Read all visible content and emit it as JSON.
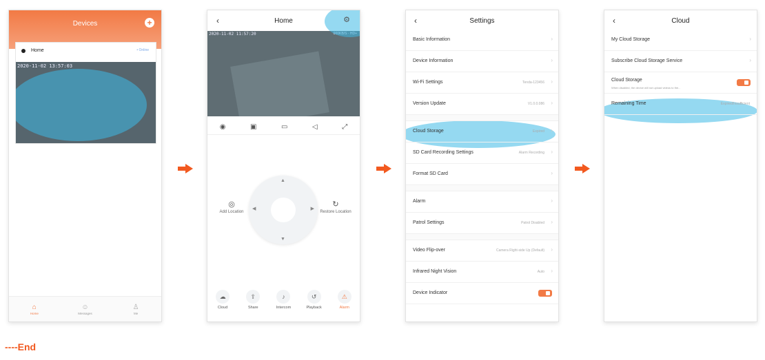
{
  "phone1": {
    "title": "Devices",
    "add_icon": "plus-icon",
    "device_name": "Home",
    "device_status": "• Online",
    "timestamp": "2020-11-02 13:57:03",
    "tabs": [
      {
        "label": "Home",
        "icon": "home-icon"
      },
      {
        "label": "Messages",
        "icon": "message-icon"
      },
      {
        "label": "Me",
        "icon": "user-icon"
      }
    ]
  },
  "phone2": {
    "title": "Home",
    "timestamp": "2020-11-02 11:57:20",
    "video_info": "000KB/S · HD+",
    "controls": [
      "eye-icon",
      "camera-icon",
      "record-icon",
      "speaker-icon",
      "fullscreen-icon"
    ],
    "add_location": "Add Location",
    "restore_location": "Restore Location",
    "bottom": [
      {
        "label": "Cloud",
        "icon": "cloud-icon"
      },
      {
        "label": "Share",
        "icon": "share-icon"
      },
      {
        "label": "Intercom",
        "icon": "mic-icon"
      },
      {
        "label": "Playback",
        "icon": "playback-icon"
      },
      {
        "label": "Alarm",
        "icon": "alarm-icon"
      }
    ]
  },
  "phone3": {
    "title": "Settings",
    "items": [
      {
        "label": "Basic Information",
        "value": ""
      },
      {
        "label": "Device Information",
        "value": ""
      },
      {
        "label": "Wi-Fi Settings",
        "value": "Tenda-123456"
      },
      {
        "label": "Version Update",
        "value": "V1.0.0.086"
      },
      {
        "label": "Cloud Storage",
        "value": "Expired"
      },
      {
        "label": "SD Card Recording Settings",
        "value": "Alarm Recording"
      },
      {
        "label": "Format SD Card",
        "value": ""
      },
      {
        "label": "Alarm",
        "value": ""
      },
      {
        "label": "Patrol Settings",
        "value": "Patrol Disabled"
      },
      {
        "label": "Video Flip-over",
        "value": "Camera Right-side Up (Default)"
      },
      {
        "label": "Infrared Night Vision",
        "value": "Auto"
      },
      {
        "label": "Device Indicator",
        "value": ""
      }
    ]
  },
  "phone4": {
    "title": "Cloud",
    "items": [
      {
        "label": "My Cloud Storage"
      },
      {
        "label": "Subscribe Cloud Storage Service"
      },
      {
        "label": "Cloud Storage",
        "sub": "When disabled, the device will not upload videos to the..."
      },
      {
        "label": "Remaining Time",
        "value": "Expired/Insufficient"
      }
    ]
  },
  "footer": {
    "end": "----End"
  },
  "colors": {
    "accent": "#f2591f",
    "highlight": "#3eb9e6"
  }
}
